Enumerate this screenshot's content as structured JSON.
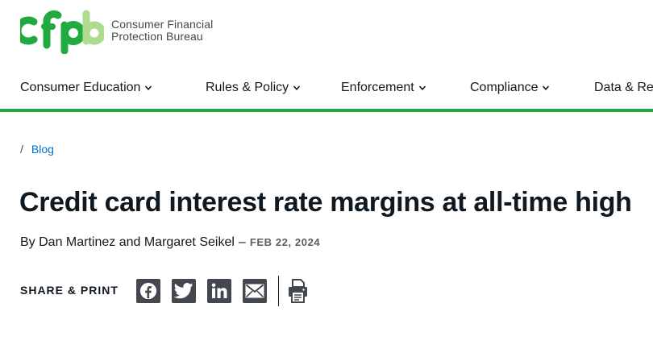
{
  "brand": {
    "mark": "cfpb",
    "name_line1": "Consumer Financial",
    "name_line2": "Protection Bureau",
    "color_green": "#20aa3f",
    "color_light_green": "#addc91"
  },
  "nav": {
    "items": [
      {
        "label": "Consumer Education"
      },
      {
        "label": "Rules & Policy"
      },
      {
        "label": "Enforcement"
      },
      {
        "label": "Compliance"
      },
      {
        "label": "Data & Re"
      }
    ]
  },
  "breadcrumb": {
    "separator": "/",
    "link": "Blog"
  },
  "article": {
    "title": "Credit card interest rate margins at all-time high",
    "byline": "By Dan Martinez and Margaret Seikel",
    "separator": "–",
    "date": "FEB 22, 2024"
  },
  "share": {
    "label": "SHARE & PRINT",
    "icons": [
      "facebook-icon",
      "twitter-icon",
      "linkedin-icon",
      "email-icon",
      "print-icon"
    ]
  }
}
